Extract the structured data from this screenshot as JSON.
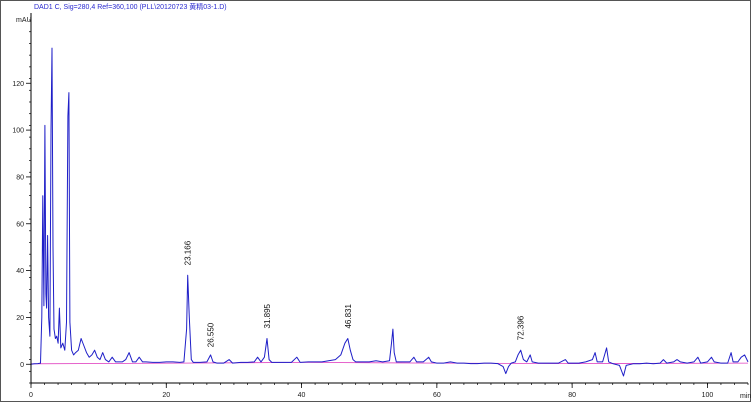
{
  "chart_data": {
    "type": "line",
    "title": "DAD1 C, Sig=280,4 Ref=360,100 (PLL\\20120723 黄精03-1.D)",
    "ylabel": "mAU",
    "xlabel": "min",
    "xlim": [
      0,
      106
    ],
    "ylim": [
      -8,
      150
    ],
    "x_ticks": [
      0,
      20,
      40,
      60,
      80,
      100
    ],
    "y_ticks": [
      0,
      20,
      40,
      60,
      80,
      100,
      120
    ],
    "minor_x_step": 2,
    "minor_y_step": 5,
    "colors": {
      "signal": "#1f1fc8",
      "baseline": "#e040c0",
      "axis": "#000000",
      "title": "#2a2ad0"
    },
    "peak_labels": [
      {
        "x": 23.166,
        "label": "23.166",
        "y_top": 41
      },
      {
        "x": 26.55,
        "label": "26.550",
        "y_top": 6
      },
      {
        "x": 34.895,
        "label": "31.895",
        "y_top": 14
      },
      {
        "x": 46.831,
        "label": "46.831",
        "y_top": 14
      },
      {
        "x": 72.396,
        "label": "72.396",
        "y_top": 9
      }
    ],
    "series": [
      {
        "values": [
          [
            0,
            0
          ],
          [
            0.5,
            0.2
          ],
          [
            1.0,
            0.3
          ],
          [
            1.4,
            0.5
          ],
          [
            1.6,
            20
          ],
          [
            1.75,
            72
          ],
          [
            1.9,
            25
          ],
          [
            2.05,
            102
          ],
          [
            2.2,
            30
          ],
          [
            2.3,
            24
          ],
          [
            2.45,
            55
          ],
          [
            2.6,
            20
          ],
          [
            2.8,
            12
          ],
          [
            2.95,
            100
          ],
          [
            3.1,
            135
          ],
          [
            3.25,
            50
          ],
          [
            3.4,
            15
          ],
          [
            3.6,
            11
          ],
          [
            3.8,
            12
          ],
          [
            4.0,
            9
          ],
          [
            4.2,
            24
          ],
          [
            4.4,
            7
          ],
          [
            4.7,
            9
          ],
          [
            5.0,
            6
          ],
          [
            5.25,
            18
          ],
          [
            5.45,
            106
          ],
          [
            5.6,
            116
          ],
          [
            5.75,
            18
          ],
          [
            6.0,
            6
          ],
          [
            6.3,
            4
          ],
          [
            6.6,
            5
          ],
          [
            7.0,
            6
          ],
          [
            7.4,
            11
          ],
          [
            7.8,
            8
          ],
          [
            8.2,
            5
          ],
          [
            8.6,
            3
          ],
          [
            9.0,
            4
          ],
          [
            9.4,
            6
          ],
          [
            9.8,
            3
          ],
          [
            10.2,
            2
          ],
          [
            10.6,
            5
          ],
          [
            11.0,
            2
          ],
          [
            11.5,
            1
          ],
          [
            12.0,
            3
          ],
          [
            12.5,
            1
          ],
          [
            13.0,
            1
          ],
          [
            13.5,
            1
          ],
          [
            14.0,
            2
          ],
          [
            14.5,
            5
          ],
          [
            15.0,
            1
          ],
          [
            15.5,
            1
          ],
          [
            16.0,
            3
          ],
          [
            16.5,
            1
          ],
          [
            17.0,
            1
          ],
          [
            18.0,
            0.8
          ],
          [
            19.0,
            0.8
          ],
          [
            20.0,
            1
          ],
          [
            21.0,
            1
          ],
          [
            22.0,
            0.8
          ],
          [
            22.6,
            1
          ],
          [
            23.0,
            15
          ],
          [
            23.166,
            38
          ],
          [
            23.4,
            20
          ],
          [
            23.7,
            2
          ],
          [
            24.0,
            0.8
          ],
          [
            25.0,
            0.8
          ],
          [
            26.0,
            1
          ],
          [
            26.55,
            4
          ],
          [
            26.9,
            1
          ],
          [
            27.5,
            0.5
          ],
          [
            28.5,
            0.5
          ],
          [
            29.3,
            2
          ],
          [
            29.8,
            0.5
          ],
          [
            31.0,
            0.8
          ],
          [
            32.0,
            0.8
          ],
          [
            33.0,
            1
          ],
          [
            33.5,
            3
          ],
          [
            34.0,
            1
          ],
          [
            34.5,
            3
          ],
          [
            34.895,
            11
          ],
          [
            35.2,
            2
          ],
          [
            35.6,
            0.8
          ],
          [
            36.5,
            0.8
          ],
          [
            37.5,
            0.8
          ],
          [
            38.5,
            0.8
          ],
          [
            39.3,
            3
          ],
          [
            39.8,
            0.8
          ],
          [
            41.0,
            1
          ],
          [
            42.0,
            1
          ],
          [
            43.0,
            1
          ],
          [
            44.0,
            1.5
          ],
          [
            45.0,
            2
          ],
          [
            45.8,
            4
          ],
          [
            46.4,
            9
          ],
          [
            46.831,
            11
          ],
          [
            47.2,
            6
          ],
          [
            47.6,
            2
          ],
          [
            48.0,
            1
          ],
          [
            49.0,
            1
          ],
          [
            50.0,
            1
          ],
          [
            51.0,
            1.5
          ],
          [
            52.0,
            1
          ],
          [
            53.0,
            1.5
          ],
          [
            53.3,
            9
          ],
          [
            53.5,
            15
          ],
          [
            53.7,
            5
          ],
          [
            54.0,
            1
          ],
          [
            55.0,
            1
          ],
          [
            56.0,
            1
          ],
          [
            56.6,
            3
          ],
          [
            57.0,
            1
          ],
          [
            58.0,
            1
          ],
          [
            58.8,
            3
          ],
          [
            59.2,
            1
          ],
          [
            60.0,
            0.5
          ],
          [
            61.0,
            0.5
          ],
          [
            62.0,
            1
          ],
          [
            63.0,
            0.5
          ],
          [
            64.0,
            0.5
          ],
          [
            65.0,
            0.3
          ],
          [
            66.0,
            0.3
          ],
          [
            67.0,
            0.5
          ],
          [
            68.0,
            0.5
          ],
          [
            69.0,
            0.3
          ],
          [
            69.8,
            -1
          ],
          [
            70.2,
            -4
          ],
          [
            70.6,
            -1
          ],
          [
            71.0,
            0.5
          ],
          [
            71.6,
            1
          ],
          [
            72.0,
            4
          ],
          [
            72.396,
            6
          ],
          [
            72.8,
            2
          ],
          [
            73.3,
            1
          ],
          [
            73.8,
            4
          ],
          [
            74.1,
            1
          ],
          [
            75.0,
            0.5
          ],
          [
            76.0,
            0.5
          ],
          [
            77.0,
            0.5
          ],
          [
            78.0,
            0.5
          ],
          [
            79.0,
            2
          ],
          [
            79.4,
            0.5
          ],
          [
            80.0,
            0.5
          ],
          [
            81.0,
            0.5
          ],
          [
            82.0,
            1
          ],
          [
            83.0,
            2
          ],
          [
            83.4,
            5
          ],
          [
            83.7,
            1
          ],
          [
            84.5,
            1
          ],
          [
            85.1,
            7
          ],
          [
            85.4,
            1
          ],
          [
            86.0,
            0.3
          ],
          [
            87.0,
            -0.5
          ],
          [
            87.6,
            -5
          ],
          [
            88.0,
            -0.5
          ],
          [
            89.0,
            0.2
          ],
          [
            90.0,
            0.2
          ],
          [
            91.0,
            0.5
          ],
          [
            92.0,
            0.2
          ],
          [
            93.0,
            0.5
          ],
          [
            93.5,
            2
          ],
          [
            94.0,
            0.5
          ],
          [
            95.0,
            1
          ],
          [
            95.5,
            2
          ],
          [
            96.0,
            1
          ],
          [
            97.0,
            0.5
          ],
          [
            98.0,
            1
          ],
          [
            98.6,
            3
          ],
          [
            99.0,
            0.5
          ],
          [
            100.0,
            1
          ],
          [
            100.6,
            3
          ],
          [
            101.0,
            1
          ],
          [
            102.0,
            0.5
          ],
          [
            103.0,
            0.5
          ],
          [
            103.5,
            5
          ],
          [
            103.8,
            1
          ],
          [
            104.5,
            1
          ],
          [
            105.0,
            3
          ],
          [
            105.5,
            4
          ],
          [
            106.0,
            1
          ]
        ]
      }
    ],
    "baseline": [
      [
        0,
        0.2
      ],
      [
        22,
        0.5
      ],
      [
        40,
        0.8
      ],
      [
        60,
        0.5
      ],
      [
        80,
        0.3
      ],
      [
        106,
        0.5
      ]
    ]
  }
}
